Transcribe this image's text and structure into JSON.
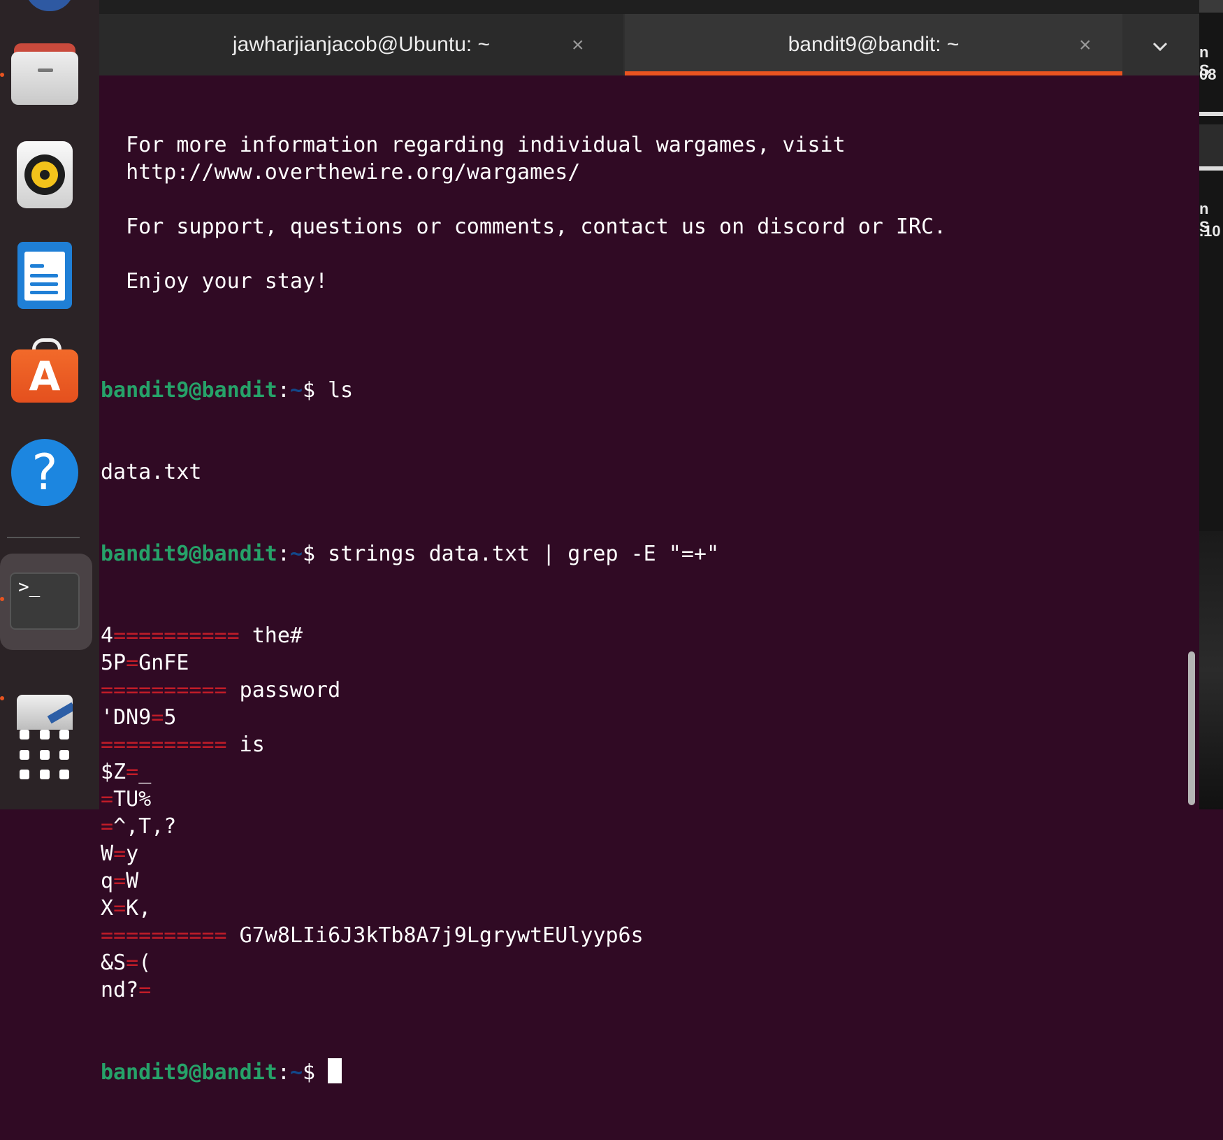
{
  "dock": {
    "items": [
      {
        "name": "files",
        "icon": "files-icon"
      },
      {
        "name": "rhythmbox",
        "icon": "music-player-icon"
      },
      {
        "name": "writer",
        "icon": "document-writer-icon"
      },
      {
        "name": "software",
        "icon": "app-store-icon"
      },
      {
        "name": "help",
        "icon": "help-icon"
      },
      {
        "name": "terminal",
        "icon": "terminal-icon"
      },
      {
        "name": "text-editor",
        "icon": "text-editor-icon"
      },
      {
        "name": "show-apps",
        "icon": "app-grid-icon"
      }
    ],
    "software_glyph": "A",
    "help_glyph": "?",
    "terminal_glyph": ">_"
  },
  "tabs": [
    {
      "label": "jawharjianjacob@Ubuntu: ~",
      "active": false
    },
    {
      "label": "bandit9@bandit: ~",
      "active": true
    }
  ],
  "colors": {
    "terminal_bg": "#300a24",
    "prompt_user": "#26a269",
    "prompt_path": "#12488b",
    "grep_match": "#c01c28",
    "tab_active_indicator": "#e95420"
  },
  "terminal": {
    "motd": [
      "  For more information regarding individual wargames, visit",
      "  http://www.overthewire.org/wargames/",
      "",
      "  For support, questions or comments, contact us on discord or IRC.",
      "",
      "  Enjoy your stay!",
      ""
    ],
    "prompt_user": "bandit9@bandit",
    "prompt_sep": ":",
    "prompt_path": "~",
    "prompt_symbol": "$ ",
    "cmd1": "ls",
    "out1": "data.txt",
    "cmd2": "strings data.txt | grep -E \"=+\"",
    "grep_lines": [
      [
        {
          "t": "4"
        },
        {
          "t": "==========",
          "m": true
        },
        {
          "t": " the#"
        }
      ],
      [
        {
          "t": "5P"
        },
        {
          "t": "=",
          "m": true
        },
        {
          "t": "GnFE"
        }
      ],
      [
        {
          "t": "==========",
          "m": true
        },
        {
          "t": " password"
        }
      ],
      [
        {
          "t": "'DN9"
        },
        {
          "t": "=",
          "m": true
        },
        {
          "t": "5"
        }
      ],
      [
        {
          "t": "==========",
          "m": true
        },
        {
          "t": " is"
        }
      ],
      [
        {
          "t": "$Z"
        },
        {
          "t": "=",
          "m": true
        },
        {
          "t": "_"
        }
      ],
      [
        {
          "t": "=",
          "m": true
        },
        {
          "t": "TU%"
        }
      ],
      [
        {
          "t": "=",
          "m": true
        },
        {
          "t": "^,T,?"
        }
      ],
      [
        {
          "t": "W"
        },
        {
          "t": "=",
          "m": true
        },
        {
          "t": "y"
        }
      ],
      [
        {
          "t": "q"
        },
        {
          "t": "=",
          "m": true
        },
        {
          "t": "W"
        }
      ],
      [
        {
          "t": "X"
        },
        {
          "t": "=",
          "m": true
        },
        {
          "t": "K,"
        }
      ],
      [
        {
          "t": "==========",
          "m": true
        },
        {
          "t": " G7w8LIi6J3kTb8A7j9LgrywtEUlyyp6s"
        }
      ],
      [
        {
          "t": "&S"
        },
        {
          "t": "=",
          "m": true
        },
        {
          "t": "("
        }
      ],
      [
        {
          "t": "nd?"
        },
        {
          "t": "=",
          "m": true
        }
      ]
    ]
  },
  "background_window": {
    "fragments": [
      "n S",
      "08",
      "n S",
      ".10"
    ]
  }
}
